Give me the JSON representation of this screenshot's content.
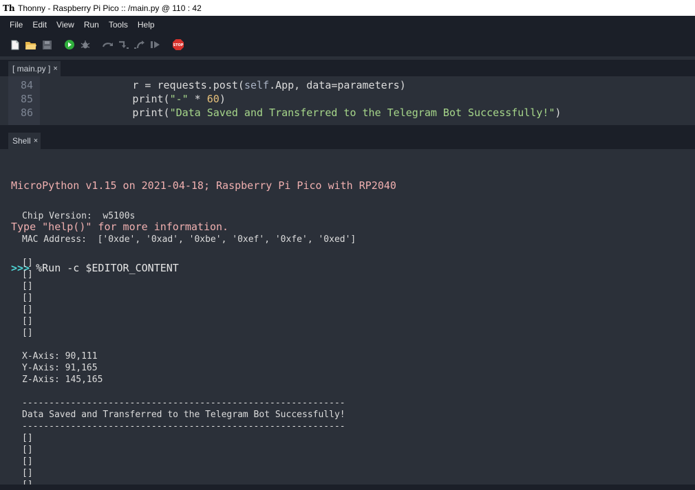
{
  "window": {
    "title": "Thonny  -  Raspberry Pi Pico :: /main.py  @  110 : 42",
    "logo_text": "Th"
  },
  "menu": [
    "File",
    "Edit",
    "View",
    "Run",
    "Tools",
    "Help"
  ],
  "toolbar": {
    "icons": [
      "new-file-icon",
      "open-folder-icon",
      "save-icon",
      "run-icon",
      "debug-icon",
      "step-over-icon",
      "step-into-icon",
      "step-out-icon",
      "resume-icon",
      "stop-icon"
    ],
    "stop_label": "STOP"
  },
  "editor": {
    "tab_label": "[ main.py ]",
    "tab_close": "×",
    "lines": [
      {
        "number": "84",
        "indent": "            ",
        "parts": [
          {
            "t": "r = requests.post(",
            "c": ""
          },
          {
            "t": "self",
            "c": "kw-self"
          },
          {
            "t": ".App, data=parameters)",
            "c": ""
          }
        ]
      },
      {
        "number": "85",
        "indent": "            ",
        "parts": [
          {
            "t": "print(",
            "c": ""
          },
          {
            "t": "\"-\"",
            "c": "str"
          },
          {
            "t": " * ",
            "c": ""
          },
          {
            "t": "60",
            "c": "num"
          },
          {
            "t": ")",
            "c": ""
          }
        ]
      },
      {
        "number": "86",
        "indent": "            ",
        "parts": [
          {
            "t": "print(",
            "c": ""
          },
          {
            "t": "\"Data Saved and Transferred to the Telegram Bot Successfully!\"",
            "c": "str"
          },
          {
            "t": ")",
            "c": ""
          }
        ]
      }
    ]
  },
  "shell": {
    "tab_label": "Shell",
    "tab_close": "×",
    "banner_line1": "MicroPython v1.15 on 2021-04-18; Raspberry Pi Pico with RP2040",
    "banner_line2": "Type \"help()\" for more information.",
    "prompt": ">>>",
    "command": " %Run -c $EDITOR_CONTENT",
    "output": [
      "",
      "Chip Version:  w5100s",
      "",
      "MAC Address:  ['0xde', '0xad', '0xbe', '0xef', '0xfe', '0xed']",
      "",
      "[]",
      "[]",
      "[]",
      "[]",
      "[]",
      "[]",
      "[]",
      "",
      "X-Axis: 90,111",
      "Y-Axis: 91,165",
      "Z-Axis: 145,165",
      "",
      "------------------------------------------------------------",
      "Data Saved and Transferred to the Telegram Bot Successfully!",
      "------------------------------------------------------------",
      "[]",
      "[]",
      "[]",
      "[]",
      "[]",
      "[]"
    ]
  }
}
